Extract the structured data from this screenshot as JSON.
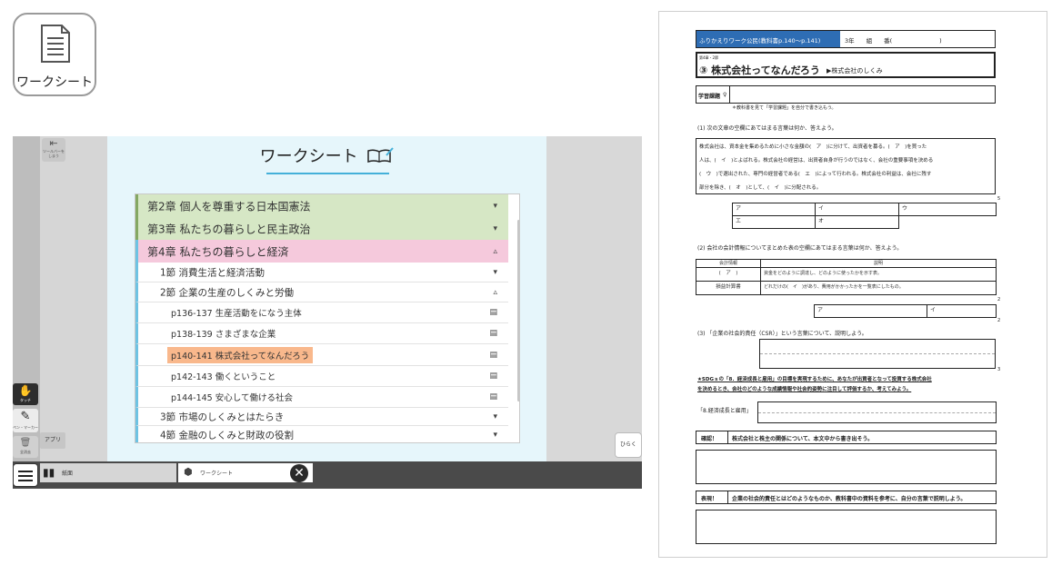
{
  "app_icon": {
    "label": "ワークシート",
    "icon": "document-icon"
  },
  "viewer": {
    "toolbar_hide_label": "ツールバーをしまう",
    "tools": [
      {
        "label": "タッチ",
        "icon": "hand-icon"
      },
      {
        "label": "ペン・マーカー",
        "icon": "pen-icon"
      },
      {
        "label": "全消去",
        "icon": "trash-icon"
      }
    ],
    "apps_label": "アプリ",
    "open_label": "ひらく",
    "title": "ワークシート",
    "tabs": [
      {
        "label": "紙面",
        "icon": "book-icon"
      },
      {
        "label": "ワークシート",
        "icon": "box-icon"
      }
    ],
    "list": [
      {
        "type": "chapter",
        "label": "第2章  個人を尊重する日本国憲法",
        "color": "#d6e7c5",
        "icon": "▾"
      },
      {
        "type": "chapter",
        "label": "第3章  私たちの暮らしと民主政治",
        "color": "#d6e7c5",
        "icon": "▾"
      },
      {
        "type": "chapter",
        "label": "第4章  私たちの暮らしと経済",
        "color": "#f5c9dc",
        "icon": "▵"
      },
      {
        "type": "section",
        "label": "1節  消費生活と経済活動",
        "icon": "▾"
      },
      {
        "type": "section",
        "label": "2節  企業の生産のしくみと労働",
        "icon": "▵"
      },
      {
        "type": "page",
        "label": "p136-137  生産活動をになう主体",
        "icon": "▤"
      },
      {
        "type": "page",
        "label": "p138-139  さまざまな企業",
        "icon": "▤"
      },
      {
        "type": "page",
        "label": "p140-141  株式会社ってなんだろう",
        "icon": "▤",
        "highlight": "#f9b88c"
      },
      {
        "type": "page",
        "label": "p142-143  働くということ",
        "icon": "▤"
      },
      {
        "type": "page",
        "label": "p144-145  安心して働ける社会",
        "icon": "▤"
      },
      {
        "type": "section",
        "label": "3節  市場のしくみとはたらき",
        "icon": "▾"
      },
      {
        "type": "section",
        "label": "4節  金融のしくみと財政の役割",
        "icon": "▾"
      }
    ]
  },
  "worksheet": {
    "header_label": "ふりかえりワーク公民(教科書p.140〜p.141)",
    "header_class": "3年　　組　　番(　　　　　　　　)",
    "chapter_small": "第4章・2節",
    "title": "③ 株式会社ってなんだろう",
    "subtitle": "▶株式会社のしくみ",
    "task_label": "学習課題",
    "task_note": "＊教科書を見て「学習課題」を自分で書き込もう。",
    "q1": "(1) 次の文章の空欄にあてはまる言葉は何か、答えよう。",
    "q1_text": [
      "株式会社は、資本金を集めるために小さな金額の(　ア　)に分けて、出資者を募る。(　ア　)を買った",
      "人は、(　イ　)とよばれる。株式会社の経営は、出資者自身が行うのではなく、会社の重要事項を決める",
      "(　ウ　)で選出された、専門の経営者である(　エ　)によって行われる。株式会社の利益は、会社に残す",
      "部分を除き、(　オ　)として、(　イ　)に分配される。"
    ],
    "q1_answers": [
      "ア",
      "イ",
      "ウ",
      "エ",
      "オ"
    ],
    "q1_points": "5",
    "q2": "(2) 会社の会計情報についてまとめた表の空欄にあてはまる言葉は何か、答えよう。",
    "q2_table": {
      "headers": [
        "会計情報",
        "説明"
      ],
      "rows": [
        [
          "(　ア　)",
          "資金をどのように調達し、どのように使ったかを示す表。"
        ],
        [
          "損益計算書",
          "どれだけの(　イ　)があり、費用がかかったかを一覧表にしたもの。"
        ]
      ]
    },
    "q2_answers": [
      "ア",
      "イ"
    ],
    "q2_points": "2",
    "q2_points2": "2",
    "q3": "(3) 「企業の社会的責任（CSR）」という言葉について、説明しよう。",
    "q3_points": "3",
    "sdgs_line1": "★SDGｓの「8．経済成長と雇用」の目標を実現するために、あなたが出資者となって投資する株式会社",
    "sdgs_line2": "を決めるとき、会社のどのような成績情報や社会的姿勢に注目して評価するか、考えてみよう。",
    "sdgs_label": "「8.経済成長と雇用」",
    "confirm_label": "確認！",
    "confirm_text": "株式会社と株主の関係について、本文中から書き出そう。",
    "express_label": "表現！",
    "express_text": "企業の社会的責任とはどのようなものか、教科書中の資料を参考に、自分の言葉で説明しよう。"
  }
}
